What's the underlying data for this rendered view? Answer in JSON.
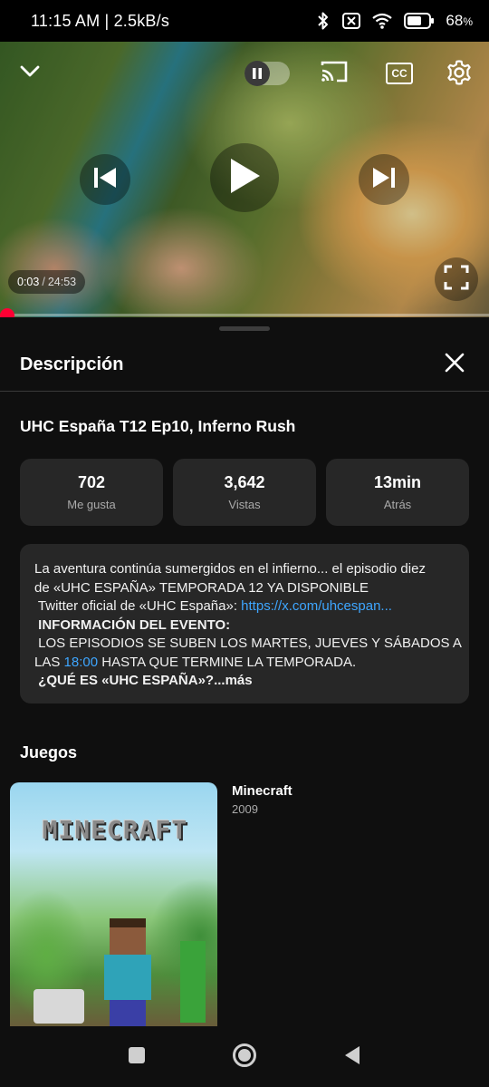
{
  "status_bar": {
    "time": "11:15 AM | 2.5kB/s",
    "battery_percent": "68",
    "battery_symbol": "%",
    "battery_level": 0.68
  },
  "player": {
    "current_time": "0:03",
    "separator": "/",
    "duration": "24:53",
    "progress": 0.002,
    "cc_label": "CC",
    "icons": [
      "chevron-down-icon",
      "pause-icon",
      "cast-icon",
      "captions-icon",
      "settings-icon",
      "previous-icon",
      "play-icon",
      "next-icon",
      "fullscreen-icon"
    ]
  },
  "sheet": {
    "title": "Descripción",
    "video_title": "UHC España T12 Ep10, Inferno Rush",
    "stats": [
      {
        "value": "702",
        "label": "Me gusta"
      },
      {
        "value": "3,642",
        "label": "Vistas"
      },
      {
        "value": "13min",
        "label": "Atrás"
      }
    ],
    "description": {
      "line1": "La aventura continúa sumergidos en el infierno... el episodio diez",
      "line2": "de «UHC ESPAÑA» TEMPORADA 12 YA DISPONIBLE",
      "line3_text": " Twitter oficial de «UHC España»: ",
      "line3_link": "https://x.com/uhcespan...",
      "line4": " INFORMACIÓN DEL EVENTO:",
      "line5": " LOS EPISODIOS SE SUBEN LOS MARTES, JUEVES Y SÁBADOS A",
      "line6_pre": "LAS ",
      "line6_link": "18:00",
      "line6_post": " HASTA QUE TERMINE LA TEMPORADA.",
      "line7_bold": " ¿QUÉ ES «UHC ESPAÑA»?",
      "more": "...más"
    },
    "games_heading": "Juegos",
    "game": {
      "logo_text": "MINECRAFT",
      "name": "Minecraft",
      "year": "2009"
    }
  },
  "nav_bar": {
    "icons": [
      "recents-square-icon",
      "home-circle-icon",
      "back-triangle-icon"
    ]
  },
  "colors": {
    "background": "#0f0f0f",
    "card": "#272727",
    "link": "#3ea6ff",
    "progress": "#ff0000"
  }
}
